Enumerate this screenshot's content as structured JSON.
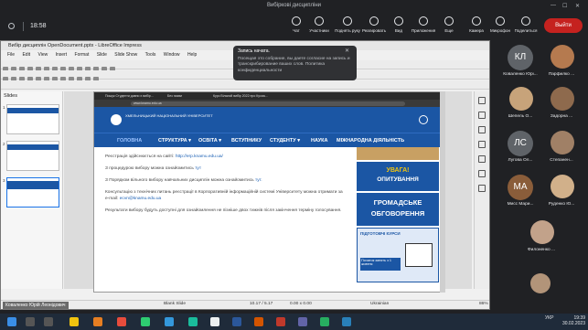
{
  "meeting": {
    "window_title": "Вибіркові дисципліни",
    "time": "18:58",
    "tools": [
      {
        "label": "Чат",
        "icon": "chat-icon"
      },
      {
        "label": "Участники",
        "icon": "people-icon"
      },
      {
        "label": "Поднять руку",
        "icon": "hand-icon"
      },
      {
        "label": "Реагировать",
        "icon": "emoji-icon"
      },
      {
        "label": "Вид",
        "icon": "grid-icon"
      },
      {
        "label": "Приложения",
        "icon": "apps-icon"
      },
      {
        "label": "Еще",
        "icon": "more-icon"
      },
      {
        "label": "Камера",
        "icon": "camera-icon"
      },
      {
        "label": "Микрофон",
        "icon": "mic-icon"
      },
      {
        "label": "Поделиться",
        "icon": "share-icon"
      }
    ],
    "leave_label": "Выйти",
    "leave_color": "#c5221f"
  },
  "recording_notice": {
    "title": "Запись начата.",
    "body": "Посещая это собрание, вы даете согласие на запись и транскрибирование ваших слов. Политика конфиденциальности"
  },
  "libreoffice": {
    "title": "Вибір дисциплін OpenDocument.pptx - LibreOffice Impress",
    "menu": [
      "File",
      "Edit",
      "View",
      "Insert",
      "Format",
      "Slide",
      "Slide Show",
      "Tools",
      "Window",
      "Help"
    ],
    "slides_pane_title": "Slides",
    "slide_numbers": [
      "1",
      "2",
      "3"
    ],
    "status": {
      "layout": "Blank Slide",
      "position": "10.17 / 5.17",
      "size": "0.00 x 0.00",
      "language": "Ukrainian",
      "zoom": "86%"
    },
    "presenter": "Коваленко Юрій Леонідович"
  },
  "browser": {
    "tabs": [
      "Пошук Студенти давно є вибір...",
      "Без назви",
      "Курс Вільний вибір 2022 про Кусиа..."
    ],
    "url": "www.knamu.edu.ua"
  },
  "website": {
    "title": "ХМЕЛЬНИЦЬКИЙ НАЦІОНАЛЬНИЙ УНІВЕРСИТЕТ",
    "nav": [
      "ГОЛОВНА",
      "СТРУКТУРА ▾",
      "ОСВІТА ▾",
      "ВСТУПНИКУ",
      "СТУДЕНТУ ▾",
      "НАУКА",
      "МІЖНАРОДНА ДІЯЛЬНІСТЬ"
    ],
    "p1_text": "Реєстрація здійснюється на сайті:",
    "p1_link": "http://erp.knamu.edu.ua/",
    "p2_text": "З процедурою вибору можна ознайомитись",
    "p2_link": "тут",
    "p3_text": "З Порядком вільного вибору навчальних дисциплін можна ознайомитись",
    "p3_link": "тут.",
    "p4_text": "Консультацію з технічних питань реєстрації в Корпоративній інформаційній системі Університету можна отримати за e-mail:",
    "p4_link": "ecvn@knamu.edu.ua",
    "p5_text": "Результати вибору будуть доступні для ознайомлення не пізніше двох тижнів після закінчення терміну голосування.",
    "ads": {
      "uvaga": "УВАГА!",
      "opytuvannia": "ОПИТУВАННЯ",
      "hromadske": "ГРОМАДСЬКЕ",
      "obgovorennia": "ОБГОВОРЕННЯ",
      "kursy": "ПІДГОТОВЧІ КУРСИ",
      "pochatok": "Початок занять з 1 жовтня"
    }
  },
  "participants": [
    {
      "name": "Коваленко Юрі...",
      "initials": "КЛ",
      "color": "#5f6368"
    },
    {
      "name": "Парфилко ...",
      "photo": "photo-1"
    },
    {
      "name": "Шепель О...",
      "photo": "photo-2"
    },
    {
      "name": "Задорна ...",
      "photo": "photo-3"
    },
    {
      "name": "Лугова Ол...",
      "initials": "ЛС",
      "color": "#5f6368"
    },
    {
      "name": "Степанен...",
      "photo": "photo-4"
    },
    {
      "name": "Мисс Мари...",
      "initials": "МА",
      "color": "#8a5d3a"
    },
    {
      "name": "Руденко Ю...",
      "photo": "photo-5"
    },
    {
      "name": "Филоненко ...",
      "photo": "photo-6"
    },
    {
      "name": "",
      "photo": "photo-7"
    }
  ],
  "taskbar": {
    "lang": "УКР",
    "clock": "19:39",
    "date": "30.02.2023"
  }
}
